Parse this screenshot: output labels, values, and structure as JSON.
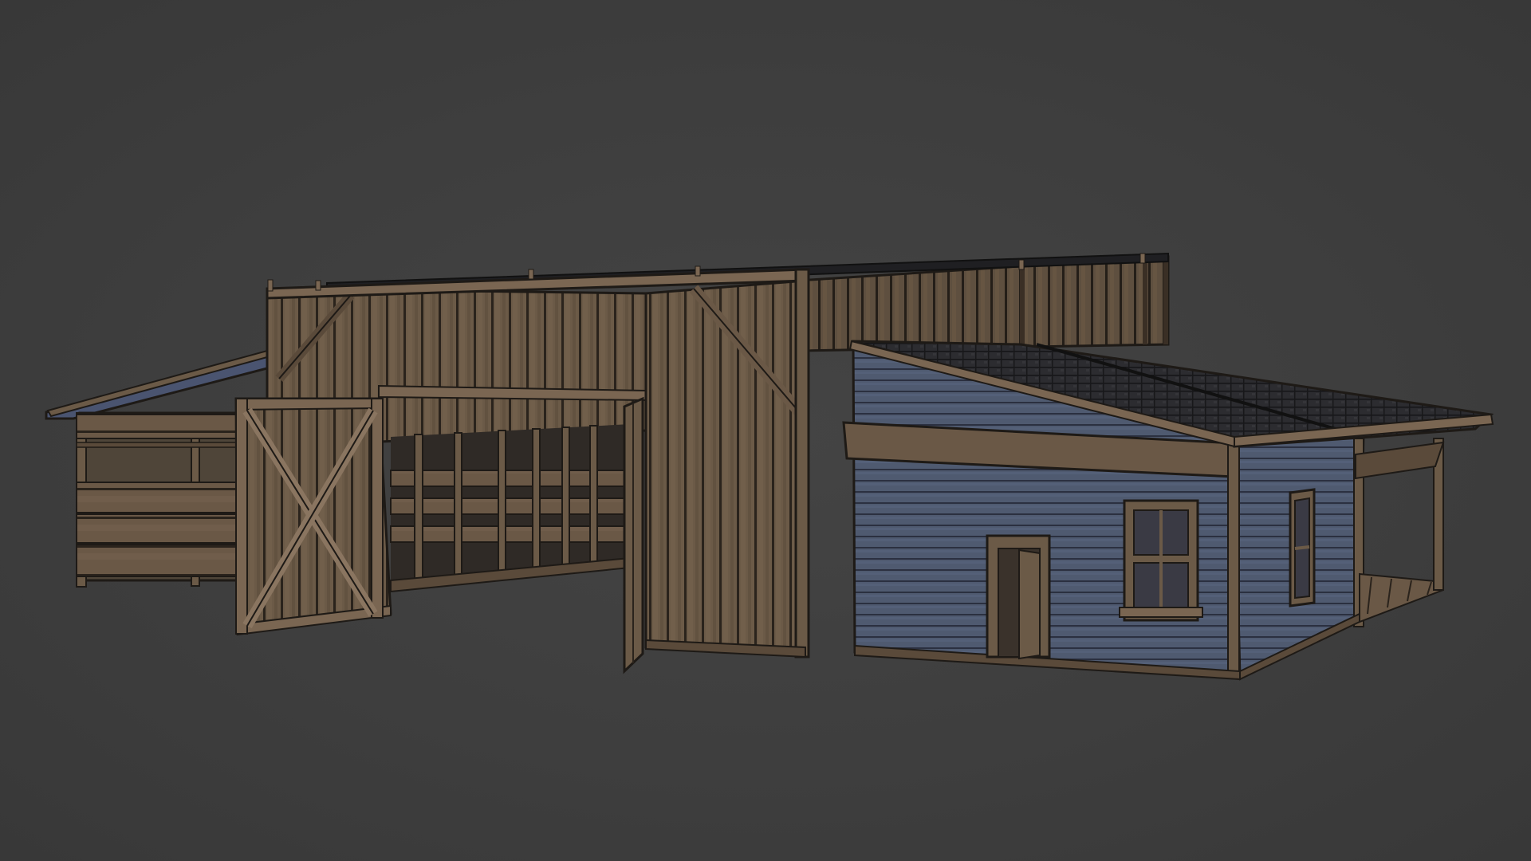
{
  "viewport": {
    "background": "#3d3d3d",
    "background_name": "dark-grey-3d-viewport"
  },
  "model": {
    "subject": "wooden-barn-with-side-shed",
    "colors": {
      "weathered_wood": "#6b5a47",
      "wood_dark": "#4a3d30",
      "wood_light": "#8a7560",
      "blue_siding": "#4f5a70",
      "blue_siding_dark": "#3e4659",
      "roof_shingles": "#2a2a2e",
      "outline": "#1e1a16"
    },
    "parts": [
      "left-open-shed",
      "open-x-braced-door",
      "central-barn-wall",
      "rear-tall-fence-wall",
      "open-interior-door",
      "blue-side-building",
      "shingle-lean-to-roof",
      "porch-awning",
      "front-door",
      "front-window",
      "side-window",
      "porch-deck"
    ]
  }
}
